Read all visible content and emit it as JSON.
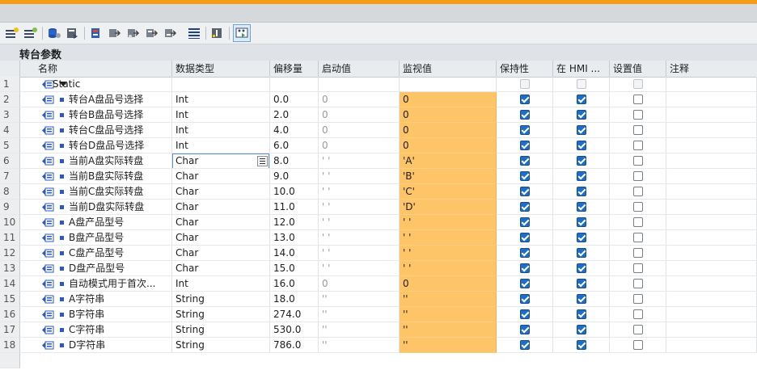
{
  "block": {
    "title": "转台参数"
  },
  "columns": [
    "名称",
    "数据类型",
    "偏移量",
    "启动值",
    "监视值",
    "保持性",
    "在 HMI ...",
    "设置值",
    "注释"
  ],
  "static_row": {
    "num": "1",
    "name": "Static"
  },
  "rows": [
    {
      "num": "2",
      "name": "转台A盘品号选择",
      "type": "Int",
      "offset": "0.0",
      "start": "0",
      "monitor": "0",
      "retain": true,
      "hmi": true,
      "setpoint": false
    },
    {
      "num": "3",
      "name": "转台B盘品号选择",
      "type": "Int",
      "offset": "2.0",
      "start": "0",
      "monitor": "0",
      "retain": true,
      "hmi": true,
      "setpoint": false
    },
    {
      "num": "4",
      "name": "转台C盘品号选择",
      "type": "Int",
      "offset": "4.0",
      "start": "0",
      "monitor": "0",
      "retain": true,
      "hmi": true,
      "setpoint": false
    },
    {
      "num": "5",
      "name": "转台D盘品号选择",
      "type": "Int",
      "offset": "6.0",
      "start": "0",
      "monitor": "0",
      "retain": true,
      "hmi": true,
      "setpoint": false
    },
    {
      "num": "6",
      "name": "当前A盘实际转盘",
      "type": "Char",
      "offset": "8.0",
      "start": "' '",
      "monitor": "'A'",
      "retain": true,
      "hmi": true,
      "setpoint": false
    },
    {
      "num": "7",
      "name": "当前B盘实际转盘",
      "type": "Char",
      "offset": "9.0",
      "start": "' '",
      "monitor": "'B'",
      "retain": true,
      "hmi": true,
      "setpoint": false
    },
    {
      "num": "8",
      "name": "当前C盘实际转盘",
      "type": "Char",
      "offset": "10.0",
      "start": "' '",
      "monitor": "'C'",
      "retain": true,
      "hmi": true,
      "setpoint": false
    },
    {
      "num": "9",
      "name": "当前D盘实际转盘",
      "type": "Char",
      "offset": "11.0",
      "start": "' '",
      "monitor": "'D'",
      "retain": true,
      "hmi": true,
      "setpoint": false
    },
    {
      "num": "10",
      "name": "A盘产品型号",
      "type": "Char",
      "offset": "12.0",
      "start": "' '",
      "monitor": "' '",
      "retain": true,
      "hmi": true,
      "setpoint": false
    },
    {
      "num": "11",
      "name": "B盘产品型号",
      "type": "Char",
      "offset": "13.0",
      "start": "' '",
      "monitor": "' '",
      "retain": true,
      "hmi": true,
      "setpoint": false
    },
    {
      "num": "12",
      "name": "C盘产品型号",
      "type": "Char",
      "offset": "14.0",
      "start": "' '",
      "monitor": "' '",
      "retain": true,
      "hmi": true,
      "setpoint": false
    },
    {
      "num": "13",
      "name": "D盘产品型号",
      "type": "Char",
      "offset": "15.0",
      "start": "' '",
      "monitor": "' '",
      "retain": true,
      "hmi": true,
      "setpoint": false
    },
    {
      "num": "14",
      "name": "自动模式用于首次...",
      "type": "Int",
      "offset": "16.0",
      "start": "0",
      "monitor": "0",
      "retain": true,
      "hmi": true,
      "setpoint": false
    },
    {
      "num": "15",
      "name": "A字符串",
      "type": "String",
      "offset": "18.0",
      "start": "''",
      "monitor": "''",
      "retain": true,
      "hmi": true,
      "setpoint": false
    },
    {
      "num": "16",
      "name": "B字符串",
      "type": "String",
      "offset": "274.0",
      "start": "''",
      "monitor": "''",
      "retain": true,
      "hmi": true,
      "setpoint": false
    },
    {
      "num": "17",
      "name": "C字符串",
      "type": "String",
      "offset": "530.0",
      "start": "''",
      "monitor": "''",
      "retain": true,
      "hmi": true,
      "setpoint": false
    },
    {
      "num": "18",
      "name": "D字符串",
      "type": "String",
      "offset": "786.0",
      "start": "''",
      "monitor": "''",
      "retain": true,
      "hmi": true,
      "setpoint": false
    }
  ],
  "colors": {
    "accent_bar": "#f39c16",
    "monitor_bg": "#fdc468",
    "checkbox_on": "#1e6ec8"
  },
  "toolbar_icons": [
    "insert-row-icon",
    "add-row-icon",
    "expand-icon",
    "load-start-values-icon",
    "snapshot-icon",
    "copy-snapshot-icon",
    "copy-snapshot-to-start-icon",
    "load-snapshot-icon",
    "apply-snapshot-icon",
    "list-view-icon",
    "keep-actual-values-icon",
    "monitor-all-icon"
  ]
}
